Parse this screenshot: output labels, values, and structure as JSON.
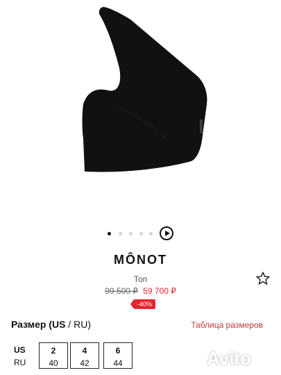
{
  "product": {
    "brand": "MÔNOT",
    "type": "Топ",
    "old_price": "99 500 ₽",
    "new_price": "59 700 ₽",
    "discount": "-40%"
  },
  "gallery": {
    "total": 5,
    "active_index": 0
  },
  "sizes": {
    "title_us": "Размер (US",
    "title_sep": " / ",
    "title_ru": "RU)",
    "table_link": "Таблица размеров",
    "row_us_label": "US",
    "row_ru_label": "RU",
    "options": [
      {
        "us": "2",
        "ru": "40"
      },
      {
        "us": "4",
        "ru": "42"
      },
      {
        "us": "6",
        "ru": "44"
      }
    ]
  },
  "watermark": "Avito",
  "colors": {
    "accent": "#e3262e",
    "text": "#111111"
  }
}
